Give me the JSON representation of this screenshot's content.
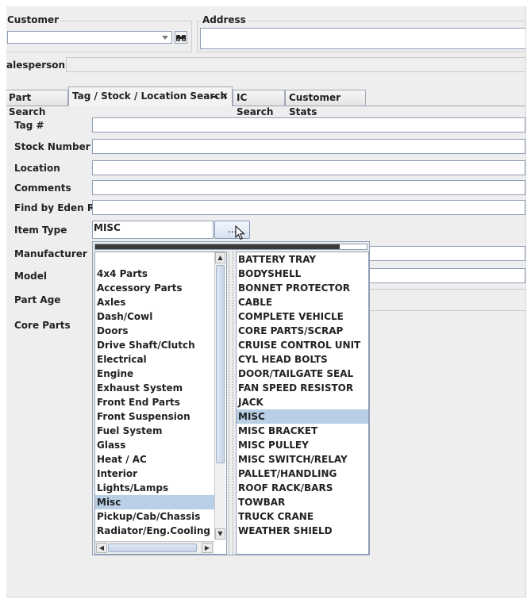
{
  "header": {
    "customer_label": "Customer",
    "address_label": "Address",
    "salesperson_label": "alesperson"
  },
  "tabs": [
    {
      "label": "Part Search"
    },
    {
      "label": "Tag / Stock / Location Search"
    },
    {
      "label": "IC Search"
    },
    {
      "label": "Customer Stats"
    }
  ],
  "form": {
    "tag_label": "Tag #",
    "stock_label": "Stock Number",
    "location_label": "Location",
    "comments_label": "Comments",
    "eden_label": "Find by Eden R#",
    "item_type_label": "Item Type",
    "item_type_value": "MISC",
    "item_type_button": "...",
    "manufacturer_label": "Manufacturer",
    "model_label": "Model",
    "part_age_label": "Part Age",
    "core_parts_label": "Core Parts"
  },
  "popup": {
    "progress": 0.9,
    "categories": [
      "4x4 Parts",
      "Accessory Parts",
      "Axles",
      "Dash/Cowl",
      "Doors",
      "Drive Shaft/Clutch",
      "Electrical",
      "Engine",
      "Exhaust System",
      "Front End Parts",
      "Front Suspension",
      "Fuel System",
      "Glass",
      "Heat / AC",
      "Interior",
      "Lights/Lamps",
      "Misc",
      "Pickup/Cab/Chassis",
      "Radiator/Eng.Cooling"
    ],
    "selected_category": "Misc",
    "items": [
      "BATTERY TRAY",
      "BODYSHELL",
      "BONNET PROTECTOR",
      "CABLE",
      "COMPLETE VEHICLE",
      "CORE PARTS/SCRAP",
      "CRUISE CONTROL UNIT",
      "CYL HEAD BOLTS",
      "DOOR/TAILGATE SEAL",
      "FAN SPEED RESISTOR",
      "JACK",
      "MISC",
      "MISC BRACKET",
      "MISC PULLEY",
      "MISC SWITCH/RELAY",
      "PALLET/HANDLING",
      "ROOF RACK/BARS",
      "TOWBAR",
      "TRUCK CRANE",
      "WEATHER SHIELD"
    ],
    "selected_item": "MISC"
  },
  "icons": {
    "binoculars": "binoculars-icon",
    "close": "close-icon",
    "minimize": "minimize-icon",
    "cursor": "mouse-cursor-icon"
  },
  "colors": {
    "selection": "#b8cfe5",
    "field_border": "#8f9fb5",
    "window_bg": "#eeeeee"
  }
}
